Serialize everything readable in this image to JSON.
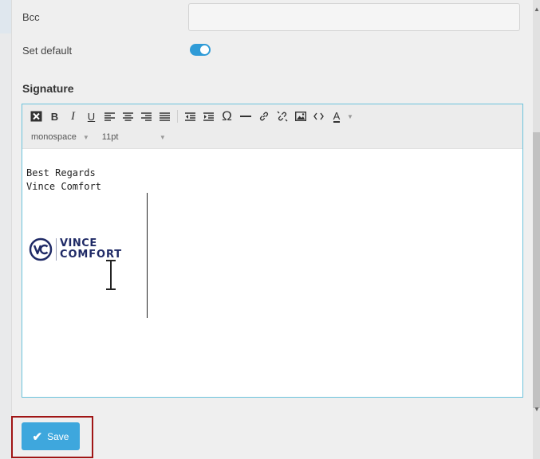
{
  "form": {
    "bcc_label": "Bcc",
    "bcc_value": "",
    "set_default_label": "Set default",
    "set_default_on": true
  },
  "signature": {
    "title": "Signature",
    "toolbar": {
      "buttons": [
        "clear-formatting-icon",
        "bold-icon",
        "italic-icon",
        "underline-icon",
        "align-left-icon",
        "align-center-icon",
        "align-right-icon",
        "justify-icon",
        "outdent-icon",
        "indent-icon",
        "special-character-icon",
        "horizontal-rule-icon",
        "link-icon",
        "unlink-icon",
        "image-icon",
        "source-code-icon",
        "text-color-icon"
      ],
      "font_family": "monospace",
      "font_size": "11pt"
    },
    "body_lines": [
      "Best Regards",
      "Vince Comfort"
    ],
    "logo": {
      "mark": "VC",
      "line1": "VINCE",
      "line2": "COMFORT"
    }
  },
  "actions": {
    "save_label": "Save"
  },
  "colors": {
    "accent": "#3ea7dd",
    "toggle": "#2f9bd7",
    "editor_border": "#6cc3dc",
    "highlight": "#a01515",
    "logo": "#1f2a66"
  }
}
